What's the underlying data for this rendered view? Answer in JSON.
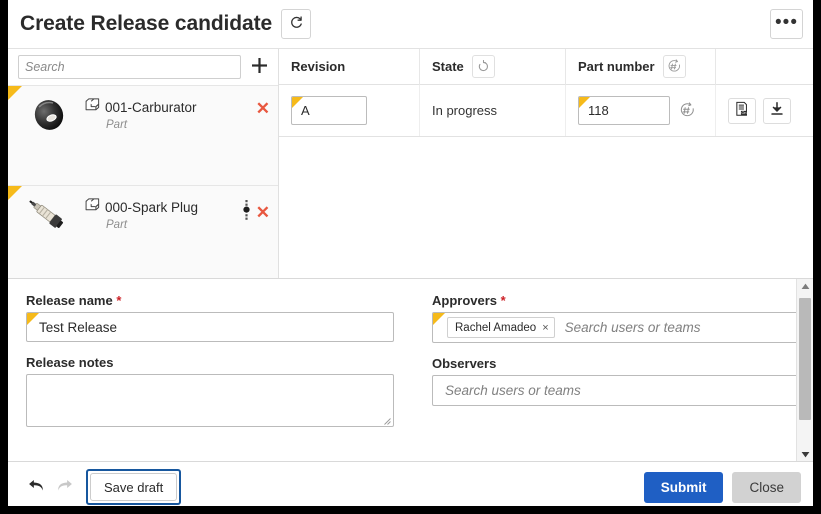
{
  "header": {
    "title": "Create Release candidate",
    "refresh_icon": "rotate-ccw-icon",
    "overflow_label": "•••"
  },
  "list_panel": {
    "search": {
      "value": "",
      "placeholder": "Search"
    },
    "add_label": "+",
    "items": [
      {
        "name": "001-Carburator",
        "type": "Part",
        "thumbnail": "carburator-thumbnail",
        "remove_label": "✕",
        "has_state_dots": false
      },
      {
        "name": "000-Spark Plug",
        "type": "Part",
        "thumbnail": "spark-plug-thumbnail",
        "remove_label": "✕",
        "has_state_dots": true
      }
    ]
  },
  "table": {
    "columns": [
      {
        "label": "Revision",
        "icon": ""
      },
      {
        "label": "State",
        "icon": "revision-cycle-icon"
      },
      {
        "label": "Part number",
        "icon": "auto-number-icon"
      },
      {
        "label": "",
        "icon": ""
      }
    ],
    "rows": [
      {
        "revision": "A",
        "state": "In progress",
        "part_number": "118",
        "actions": [
          "bom-report-icon",
          "download-icon"
        ]
      }
    ]
  },
  "form": {
    "release_name": {
      "label": "Release name",
      "required": "*",
      "value": "Test Release"
    },
    "release_notes": {
      "label": "Release notes",
      "value": ""
    },
    "approvers": {
      "label": "Approvers",
      "required": "*",
      "chips": [
        {
          "name": "Rachel Amadeo",
          "remove_label": "×"
        }
      ],
      "placeholder": "Search users or teams"
    },
    "observers": {
      "label": "Observers",
      "chips": [],
      "placeholder": "Search users or teams"
    }
  },
  "footer": {
    "undo_icon": "undo-arrow-icon",
    "redo_icon": "redo-arrow-icon",
    "save_draft_label": "Save draft",
    "submit_label": "Submit",
    "close_label": "Close"
  },
  "colors": {
    "primary_blue": "#1f5fc4",
    "focus_blue": "#17579e",
    "modified_flag_yellow": "#f6ba1a",
    "remove_red": "#e8573f",
    "required_red": "#cc2026"
  }
}
